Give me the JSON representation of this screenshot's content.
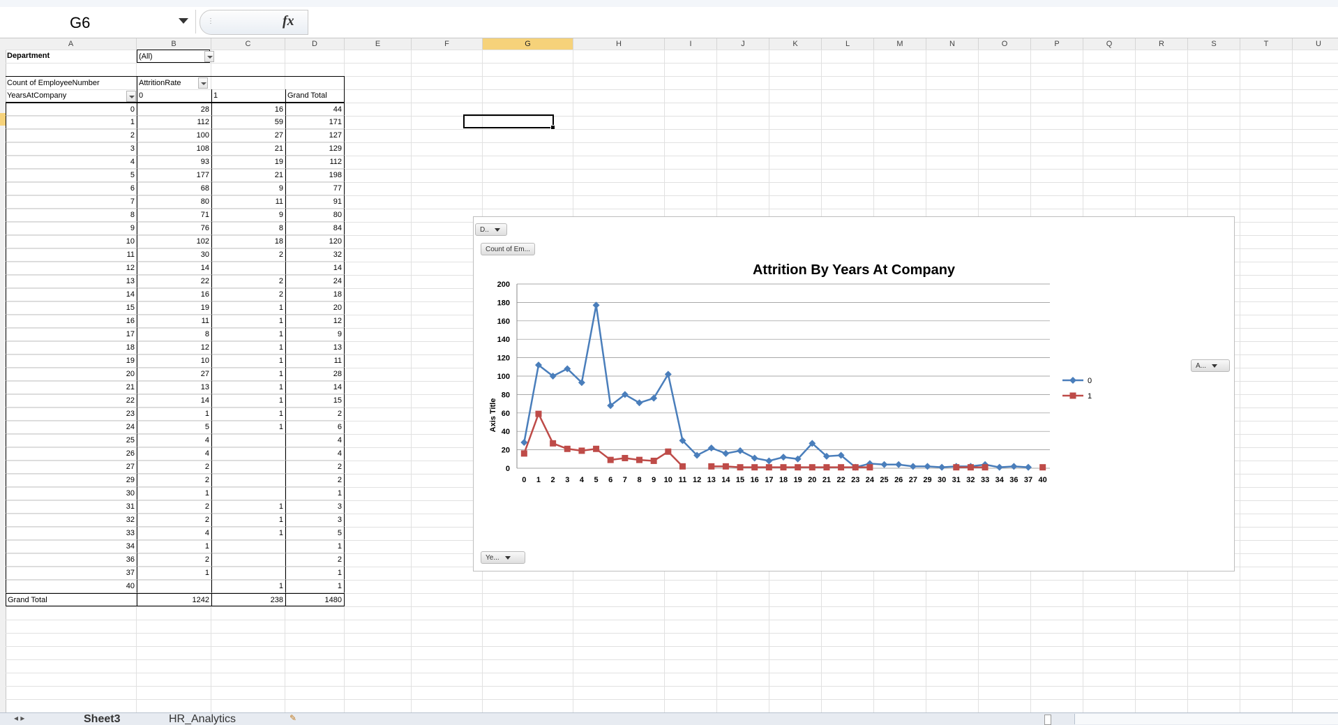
{
  "formula_bar": {
    "name_box": "G6",
    "fx_label": "fx",
    "formula": ""
  },
  "columns": [
    {
      "letter": "A",
      "w": 188
    },
    {
      "letter": "B",
      "w": 107
    },
    {
      "letter": "C",
      "w": 106
    },
    {
      "letter": "D",
      "w": 85
    },
    {
      "letter": "E",
      "w": 96
    },
    {
      "letter": "F",
      "w": 102
    },
    {
      "letter": "G",
      "w": 130
    },
    {
      "letter": "H",
      "w": 131
    },
    {
      "letter": "I",
      "w": 75
    },
    {
      "letter": "J",
      "w": 75
    },
    {
      "letter": "K",
      "w": 75
    },
    {
      "letter": "L",
      "w": 75
    },
    {
      "letter": "M",
      "w": 75
    },
    {
      "letter": "N",
      "w": 75
    },
    {
      "letter": "O",
      "w": 75
    },
    {
      "letter": "P",
      "w": 75
    },
    {
      "letter": "Q",
      "w": 75
    },
    {
      "letter": "R",
      "w": 75
    },
    {
      "letter": "S",
      "w": 75
    },
    {
      "letter": "T",
      "w": 75
    },
    {
      "letter": "U",
      "w": 75
    }
  ],
  "active_column": "G",
  "pivot": {
    "filter_label": "Department",
    "filter_value": "(All)",
    "values_label": "Count of EmployeeNumber",
    "columns_field": "AttritionRate",
    "rows_field": "YearsAtCompany",
    "col_keys": [
      "0",
      "1",
      "Grand Total"
    ],
    "rows": [
      [
        "0",
        "28",
        "16",
        "44"
      ],
      [
        "1",
        "112",
        "59",
        "171"
      ],
      [
        "2",
        "100",
        "27",
        "127"
      ],
      [
        "3",
        "108",
        "21",
        "129"
      ],
      [
        "4",
        "93",
        "19",
        "112"
      ],
      [
        "5",
        "177",
        "21",
        "198"
      ],
      [
        "6",
        "68",
        "9",
        "77"
      ],
      [
        "7",
        "80",
        "11",
        "91"
      ],
      [
        "8",
        "71",
        "9",
        "80"
      ],
      [
        "9",
        "76",
        "8",
        "84"
      ],
      [
        "10",
        "102",
        "18",
        "120"
      ],
      [
        "11",
        "30",
        "2",
        "32"
      ],
      [
        "12",
        "14",
        "",
        "14"
      ],
      [
        "13",
        "22",
        "2",
        "24"
      ],
      [
        "14",
        "16",
        "2",
        "18"
      ],
      [
        "15",
        "19",
        "1",
        "20"
      ],
      [
        "16",
        "11",
        "1",
        "12"
      ],
      [
        "17",
        "8",
        "1",
        "9"
      ],
      [
        "18",
        "12",
        "1",
        "13"
      ],
      [
        "19",
        "10",
        "1",
        "11"
      ],
      [
        "20",
        "27",
        "1",
        "28"
      ],
      [
        "21",
        "13",
        "1",
        "14"
      ],
      [
        "22",
        "14",
        "1",
        "15"
      ],
      [
        "23",
        "1",
        "1",
        "2"
      ],
      [
        "24",
        "5",
        "1",
        "6"
      ],
      [
        "25",
        "4",
        "",
        "4"
      ],
      [
        "26",
        "4",
        "",
        "4"
      ],
      [
        "27",
        "2",
        "",
        "2"
      ],
      [
        "29",
        "2",
        "",
        "2"
      ],
      [
        "30",
        "1",
        "",
        "1"
      ],
      [
        "31",
        "2",
        "1",
        "3"
      ],
      [
        "32",
        "2",
        "1",
        "3"
      ],
      [
        "33",
        "4",
        "1",
        "5"
      ],
      [
        "34",
        "1",
        "",
        "1"
      ],
      [
        "36",
        "2",
        "",
        "2"
      ],
      [
        "37",
        "1",
        "",
        "1"
      ],
      [
        "40",
        "",
        "1",
        "1"
      ]
    ],
    "grand_total": [
      "Grand Total",
      "1242",
      "238",
      "1480"
    ]
  },
  "chart_buttons": {
    "department": "D..",
    "values": "Count of Em...",
    "legend_field": "A...",
    "axis_field": "Ye..."
  },
  "chart_data": {
    "type": "line",
    "title": "Attrition By Years At Company",
    "xlabel": "",
    "ylabel": "Axis Title",
    "ylim": [
      0,
      200
    ],
    "yticks": [
      0,
      20,
      40,
      60,
      80,
      100,
      120,
      140,
      160,
      180,
      200
    ],
    "grid": true,
    "legend_position": "right",
    "categories": [
      "0",
      "1",
      "2",
      "3",
      "4",
      "5",
      "6",
      "7",
      "8",
      "9",
      "10",
      "11",
      "12",
      "13",
      "14",
      "15",
      "16",
      "17",
      "18",
      "19",
      "20",
      "21",
      "22",
      "23",
      "24",
      "25",
      "26",
      "27",
      "29",
      "30",
      "31",
      "32",
      "33",
      "34",
      "36",
      "37",
      "40"
    ],
    "series": [
      {
        "name": "0",
        "color": "#4a7ebb",
        "marker": "diamond",
        "values": [
          28,
          112,
          100,
          108,
          93,
          177,
          68,
          80,
          71,
          76,
          102,
          30,
          14,
          22,
          16,
          19,
          11,
          8,
          12,
          10,
          27,
          13,
          14,
          1,
          5,
          4,
          4,
          2,
          2,
          1,
          2,
          2,
          4,
          1,
          2,
          1,
          null
        ]
      },
      {
        "name": "1",
        "color": "#be4b48",
        "marker": "square",
        "values": [
          16,
          59,
          27,
          21,
          19,
          21,
          9,
          11,
          9,
          8,
          18,
          2,
          null,
          2,
          2,
          1,
          1,
          1,
          1,
          1,
          1,
          1,
          1,
          1,
          1,
          null,
          null,
          null,
          null,
          null,
          1,
          1,
          1,
          null,
          null,
          null,
          1
        ]
      }
    ]
  },
  "sheet_tabs": [
    "Sheet3",
    "HR_Analytics"
  ]
}
